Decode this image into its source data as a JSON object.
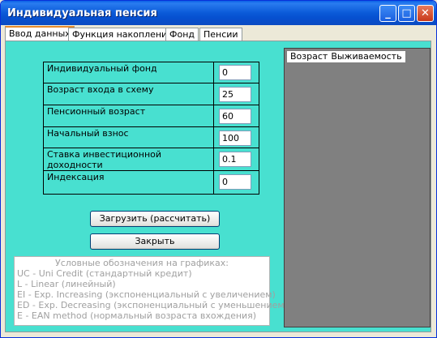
{
  "window": {
    "title": "Индивидуальная пенсия",
    "minimize_glyph": "_",
    "maximize_glyph": "□",
    "close_glyph": "✕"
  },
  "tabs": [
    {
      "label": "Ввод данных",
      "active": true
    },
    {
      "label": "Функция накопления",
      "active": false
    },
    {
      "label": "Фонд",
      "active": false
    },
    {
      "label": "Пенсии",
      "active": false
    }
  ],
  "form": {
    "rows": [
      {
        "label": "Индивидуальный фонд",
        "value": "0"
      },
      {
        "label": "Возраст входа в схему",
        "value": "25"
      },
      {
        "label": "Пенсионный возраст",
        "value": "60"
      },
      {
        "label": "Начальный взнос",
        "value": "100"
      },
      {
        "label": "Ставка инвестиционной доходности",
        "value": "0.1"
      },
      {
        "label": "Индексация",
        "value": "0"
      }
    ]
  },
  "buttons": {
    "load": "Загрузить (рассчитать)",
    "close": "Закрыть"
  },
  "legend": {
    "heading": "Условные обозначения на графиках:",
    "lines": [
      "UC - Uni Credit (стандартный кредит)",
      "L - Linear (линейный)",
      "EI - Exp. Increasing (экспоненциальный с увеличением)",
      "ED - Exp. Decreasing (экспоненциальный с уменьшением)",
      "E - EAN method (нормальный возраста вхождения)"
    ]
  },
  "grid": {
    "columns": [
      "Возраст",
      "Выживаемость"
    ]
  },
  "colors": {
    "tab_page_bg": "#48e0d0",
    "grid_bg": "#808080",
    "title_bar": "#0a5ad8"
  }
}
